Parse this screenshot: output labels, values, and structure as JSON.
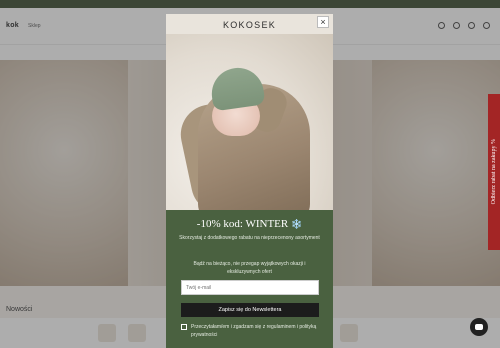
{
  "site": {
    "topbar_text": "",
    "logo": "kok",
    "header_link": "Sklep",
    "nav_items": [
      "",
      "",
      "",
      "",
      "",
      "",
      "",
      "",
      "",
      ""
    ],
    "section_title": "Nowości"
  },
  "side_tab": {
    "label": "Odbierz rabat na zakupy %"
  },
  "modal": {
    "brand": "KOKOSEK",
    "close_label": "×",
    "headline": "-10% kod: WINTER",
    "headline_emoji": "❄️",
    "subtext": "Skorzystaj z dodatkowego rabatu na nieprzecenony asortyment",
    "note": "Bądź na bieżąco, nie przegap wyjątkowych okazji i ekskluzywnych ofert",
    "email_placeholder": "Twój e-mail",
    "subscribe_label": "Zapisz się do Newslettera",
    "consent_text": "Przeczytałam/em i zgadzam się z regulaminem i polityką prywatności"
  },
  "colors": {
    "modal_green": "#4a6140",
    "side_tab_red": "#a32525",
    "button_dark": "#1c1c1c"
  },
  "icons": [
    "close-icon",
    "snowflake-icon",
    "chat-icon",
    "search-icon",
    "account-icon",
    "wishlist-icon",
    "cart-icon",
    "checkbox-icon"
  ]
}
